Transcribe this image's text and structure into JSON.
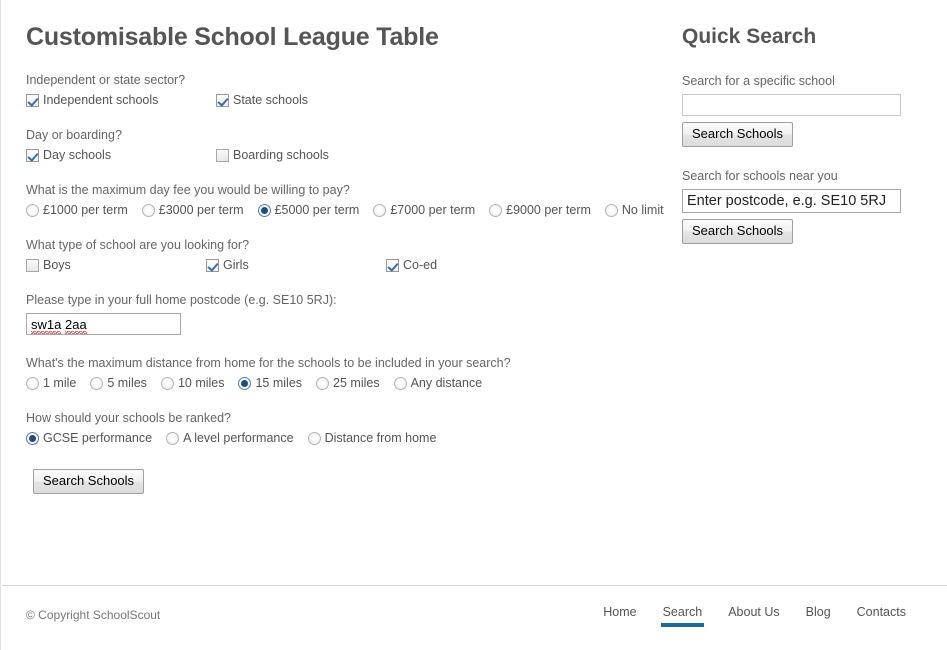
{
  "main": {
    "title": "Customisable School League Table",
    "questions": [
      {
        "label": "Independent or state sector?",
        "type": "checkbox",
        "options": [
          {
            "label": "Independent schools",
            "checked": true
          },
          {
            "label": "State schools",
            "checked": true
          }
        ]
      },
      {
        "label": "Day or boarding?",
        "type": "checkbox",
        "options": [
          {
            "label": "Day schools",
            "checked": true
          },
          {
            "label": "Boarding schools",
            "checked": false
          }
        ]
      },
      {
        "label": "What is the maximum day fee you would be willing to pay?",
        "type": "radio",
        "options": [
          {
            "label": "£1000 per term",
            "checked": false
          },
          {
            "label": "£3000 per term",
            "checked": false
          },
          {
            "label": "£5000 per term",
            "checked": true
          },
          {
            "label": "£7000 per term",
            "checked": false
          },
          {
            "label": "£9000 per term",
            "checked": false
          },
          {
            "label": "No limit",
            "checked": false
          }
        ]
      },
      {
        "label": "What type of school are you looking for?",
        "type": "checkbox",
        "options": [
          {
            "label": "Boys",
            "checked": false
          },
          {
            "label": "Girls",
            "checked": true
          },
          {
            "label": "Co-ed",
            "checked": true
          }
        ]
      },
      {
        "label": "What's the maximum distance from home for the schools to be included in your search?",
        "type": "radio",
        "options": [
          {
            "label": "1 mile",
            "checked": false
          },
          {
            "label": "5 miles",
            "checked": false
          },
          {
            "label": "10 miles",
            "checked": false
          },
          {
            "label": "15 miles",
            "checked": true
          },
          {
            "label": "25 miles",
            "checked": false
          },
          {
            "label": "Any distance",
            "checked": false
          }
        ]
      },
      {
        "label": "How should your schools be ranked?",
        "type": "radio",
        "options": [
          {
            "label": "GCSE performance",
            "checked": true
          },
          {
            "label": "A level performance",
            "checked": false
          },
          {
            "label": "Distance from home",
            "checked": false
          }
        ]
      }
    ],
    "postcode_question": {
      "label": "Please type in your full home postcode (e.g. SE10 5RJ):",
      "value_part1": "sw1a",
      "value_space": " ",
      "value_part2": "2aa",
      "full_value": "sw1a 2aa"
    },
    "submit_label": "Search Schools"
  },
  "quick_search": {
    "title": "Quick Search",
    "school_label": "Search for a specific school",
    "school_value": "",
    "school_placeholder": "",
    "school_button": "Search Schools",
    "near_label": "Search for schools near you",
    "near_value": "Enter postcode, e.g. SE10 5RJ",
    "near_button": "Search Schools"
  },
  "footer": {
    "copyright": "© Copyright SchoolScout",
    "nav": [
      {
        "label": "Home",
        "active": false
      },
      {
        "label": "Search",
        "active": true
      },
      {
        "label": "About Us",
        "active": false
      },
      {
        "label": "Blog",
        "active": false
      },
      {
        "label": "Contacts",
        "active": false
      }
    ]
  },
  "colors": {
    "accent": "#1d6a96",
    "heading": "#555555",
    "label": "#666666",
    "radio_selected": "#1c4e80",
    "checkbox_tick": "#3c6ea5",
    "spellcheck": "#e03a3a"
  }
}
